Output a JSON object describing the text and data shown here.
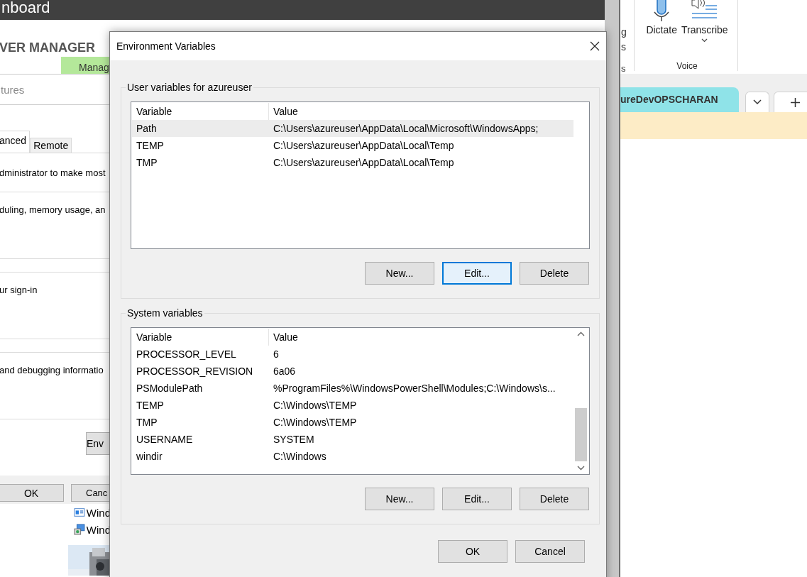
{
  "server_manager": {
    "title": "nboard",
    "heading": "VER MANAGER",
    "tab": "Manag",
    "subtitle": "tures",
    "properties_dialog": {
      "tabs": [
        {
          "label": "anced",
          "selected": true
        },
        {
          "label": "Remote",
          "selected": false
        }
      ],
      "intro": "dministrator to make most",
      "sections": [
        "duling, memory usage, an",
        "ur sign-in",
        "and debugging informatio"
      ],
      "section_button": "Env",
      "buttons": [
        "OK",
        "Canc"
      ]
    },
    "items": [
      "Wind",
      "Wind"
    ]
  },
  "word": {
    "cut_labels": [
      "g",
      "s",
      "s"
    ],
    "voice_buttons": [
      {
        "kind": "mic",
        "label": "Dictate"
      },
      {
        "kind": "transcribe",
        "label": "Transcribe"
      }
    ],
    "group_label": "Voice",
    "tabs": [
      {
        "label": "ureDevOPSCHARAN",
        "selected": true
      }
    ]
  },
  "env_dialog": {
    "title": "Environment Variables",
    "groups": [
      {
        "label": "User variables for azureuser",
        "columns": [
          "Variable",
          "Value"
        ],
        "scrollbar": false,
        "rows": [
          {
            "variable": "Path",
            "value": "C:\\Users\\azureuser\\AppData\\Local\\Microsoft\\WindowsApps;",
            "selected": true
          },
          {
            "variable": "TEMP",
            "value": "C:\\Users\\azureuser\\AppData\\Local\\Temp",
            "selected": false
          },
          {
            "variable": "TMP",
            "value": "C:\\Users\\azureuser\\AppData\\Local\\Temp",
            "selected": false
          }
        ],
        "buttons": [
          {
            "label": "New...",
            "focused": false
          },
          {
            "label": "Edit...",
            "focused": true
          },
          {
            "label": "Delete",
            "focused": false
          }
        ]
      },
      {
        "label": "System variables",
        "columns": [
          "Variable",
          "Value"
        ],
        "scrollbar": true,
        "rows": [
          {
            "variable": "PROCESSOR_LEVEL",
            "value": "6",
            "selected": false
          },
          {
            "variable": "PROCESSOR_REVISION",
            "value": "6a06",
            "selected": false
          },
          {
            "variable": "PSModulePath",
            "value": "%ProgramFiles%\\WindowsPowerShell\\Modules;C:\\Windows\\s...",
            "selected": false
          },
          {
            "variable": "TEMP",
            "value": "C:\\Windows\\TEMP",
            "selected": false
          },
          {
            "variable": "TMP",
            "value": "C:\\Windows\\TEMP",
            "selected": false
          },
          {
            "variable": "USERNAME",
            "value": "SYSTEM",
            "selected": false
          },
          {
            "variable": "windir",
            "value": "C:\\Windows",
            "selected": false
          }
        ],
        "buttons": [
          {
            "label": "New...",
            "focused": false
          },
          {
            "label": "Edit...",
            "focused": false
          },
          {
            "label": "Delete",
            "focused": false
          }
        ]
      }
    ],
    "buttons": [
      "OK",
      "Cancel"
    ]
  }
}
